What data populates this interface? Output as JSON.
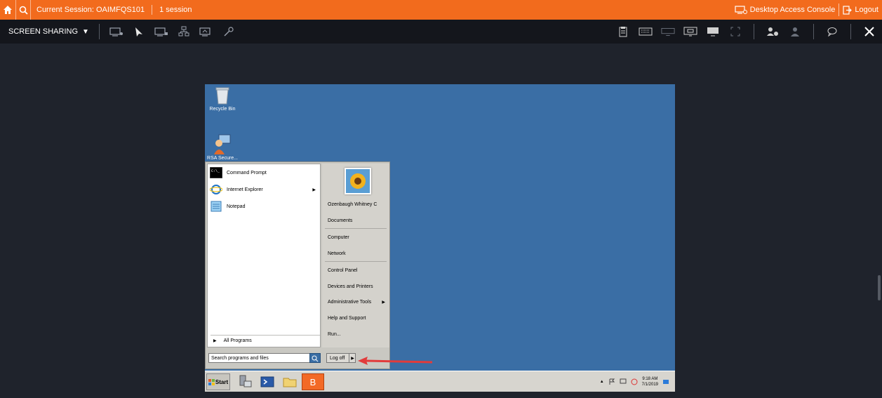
{
  "topbar": {
    "session_label": "Current Session: OAIMFQS101",
    "session_count": "1 session",
    "desktop_console_label": "Desktop Access Console",
    "logout_label": "Logout"
  },
  "toolbar": {
    "mode_label": "SCREEN SHARING"
  },
  "desktop": {
    "recycle_bin_label": "Recycle Bin",
    "shortcut_label": "RSA Secure..."
  },
  "start_menu": {
    "programs": [
      {
        "label": "Command Prompt",
        "has_submenu": false
      },
      {
        "label": "Internet Explorer",
        "has_submenu": true
      },
      {
        "label": "Notepad",
        "has_submenu": false
      }
    ],
    "all_programs_label": "All Programs",
    "search_placeholder": "Search programs and files",
    "user_name": "Ozenbaugh Whitney C",
    "right_items": [
      {
        "label": "Documents",
        "has_submenu": false
      },
      {
        "label": "Computer",
        "has_submenu": false
      },
      {
        "label": "Network",
        "has_submenu": false
      },
      {
        "label": "Control Panel",
        "has_submenu": false
      },
      {
        "label": "Devices and Printers",
        "has_submenu": false
      },
      {
        "label": "Administrative Tools",
        "has_submenu": true
      },
      {
        "label": "Help and Support",
        "has_submenu": false
      },
      {
        "label": "Run...",
        "has_submenu": false
      }
    ],
    "logoff_label": "Log off"
  },
  "taskbar": {
    "start_label": "Start",
    "app_b_label": "B",
    "time": "9:18 AM",
    "date": "7/1/2019"
  },
  "colors": {
    "accent": "#f26b1d",
    "desktop_bg": "#3a6ea5",
    "annotation_arrow": "#e23b3b"
  }
}
